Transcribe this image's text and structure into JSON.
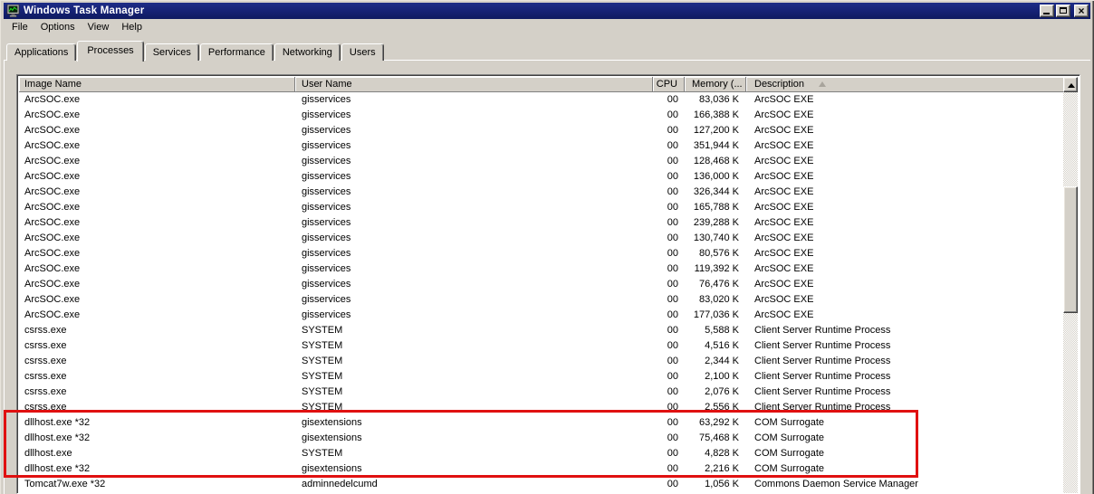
{
  "window": {
    "title": "Windows Task Manager",
    "icon": "task-manager-icon",
    "controls": [
      "minimize",
      "maximize",
      "close"
    ]
  },
  "menu": {
    "items": [
      "File",
      "Options",
      "View",
      "Help"
    ]
  },
  "tabs": {
    "active": "Processes",
    "items": [
      "Applications",
      "Processes",
      "Services",
      "Performance",
      "Networking",
      "Users"
    ]
  },
  "process_table": {
    "columns": [
      "Image Name",
      "User Name",
      "CPU",
      "Memory (...",
      "Description"
    ],
    "sorted_by": "Description",
    "sort_direction": "ascending",
    "rows": [
      {
        "image": "ArcSOC.exe",
        "user": "gisservices",
        "cpu": "00",
        "memory": "83,036 K",
        "description": "ArcSOC EXE",
        "highlighted": false
      },
      {
        "image": "ArcSOC.exe",
        "user": "gisservices",
        "cpu": "00",
        "memory": "166,388 K",
        "description": "ArcSOC EXE",
        "highlighted": false
      },
      {
        "image": "ArcSOC.exe",
        "user": "gisservices",
        "cpu": "00",
        "memory": "127,200 K",
        "description": "ArcSOC EXE",
        "highlighted": false
      },
      {
        "image": "ArcSOC.exe",
        "user": "gisservices",
        "cpu": "00",
        "memory": "351,944 K",
        "description": "ArcSOC EXE",
        "highlighted": false
      },
      {
        "image": "ArcSOC.exe",
        "user": "gisservices",
        "cpu": "00",
        "memory": "128,468 K",
        "description": "ArcSOC EXE",
        "highlighted": false
      },
      {
        "image": "ArcSOC.exe",
        "user": "gisservices",
        "cpu": "00",
        "memory": "136,000 K",
        "description": "ArcSOC EXE",
        "highlighted": false
      },
      {
        "image": "ArcSOC.exe",
        "user": "gisservices",
        "cpu": "00",
        "memory": "326,344 K",
        "description": "ArcSOC EXE",
        "highlighted": false
      },
      {
        "image": "ArcSOC.exe",
        "user": "gisservices",
        "cpu": "00",
        "memory": "165,788 K",
        "description": "ArcSOC EXE",
        "highlighted": false
      },
      {
        "image": "ArcSOC.exe",
        "user": "gisservices",
        "cpu": "00",
        "memory": "239,288 K",
        "description": "ArcSOC EXE",
        "highlighted": false
      },
      {
        "image": "ArcSOC.exe",
        "user": "gisservices",
        "cpu": "00",
        "memory": "130,740 K",
        "description": "ArcSOC EXE",
        "highlighted": false
      },
      {
        "image": "ArcSOC.exe",
        "user": "gisservices",
        "cpu": "00",
        "memory": "80,576 K",
        "description": "ArcSOC EXE",
        "highlighted": false
      },
      {
        "image": "ArcSOC.exe",
        "user": "gisservices",
        "cpu": "00",
        "memory": "119,392 K",
        "description": "ArcSOC EXE",
        "highlighted": false
      },
      {
        "image": "ArcSOC.exe",
        "user": "gisservices",
        "cpu": "00",
        "memory": "76,476 K",
        "description": "ArcSOC EXE",
        "highlighted": false
      },
      {
        "image": "ArcSOC.exe",
        "user": "gisservices",
        "cpu": "00",
        "memory": "83,020 K",
        "description": "ArcSOC EXE",
        "highlighted": false
      },
      {
        "image": "ArcSOC.exe",
        "user": "gisservices",
        "cpu": "00",
        "memory": "177,036 K",
        "description": "ArcSOC EXE",
        "highlighted": false
      },
      {
        "image": "csrss.exe",
        "user": "SYSTEM",
        "cpu": "00",
        "memory": "5,588 K",
        "description": "Client Server Runtime Process",
        "highlighted": false
      },
      {
        "image": "csrss.exe",
        "user": "SYSTEM",
        "cpu": "00",
        "memory": "4,516 K",
        "description": "Client Server Runtime Process",
        "highlighted": false
      },
      {
        "image": "csrss.exe",
        "user": "SYSTEM",
        "cpu": "00",
        "memory": "2,344 K",
        "description": "Client Server Runtime Process",
        "highlighted": false
      },
      {
        "image": "csrss.exe",
        "user": "SYSTEM",
        "cpu": "00",
        "memory": "2,100 K",
        "description": "Client Server Runtime Process",
        "highlighted": false
      },
      {
        "image": "csrss.exe",
        "user": "SYSTEM",
        "cpu": "00",
        "memory": "2,076 K",
        "description": "Client Server Runtime Process",
        "highlighted": false
      },
      {
        "image": "csrss.exe",
        "user": "SYSTEM",
        "cpu": "00",
        "memory": "2,556 K",
        "description": "Client Server Runtime Process",
        "highlighted": false
      },
      {
        "image": "dllhost.exe *32",
        "user": "gisextensions",
        "cpu": "00",
        "memory": "63,292 K",
        "description": "COM Surrogate",
        "highlighted": true
      },
      {
        "image": "dllhost.exe *32",
        "user": "gisextensions",
        "cpu": "00",
        "memory": "75,468 K",
        "description": "COM Surrogate",
        "highlighted": true
      },
      {
        "image": "dllhost.exe",
        "user": "SYSTEM",
        "cpu": "00",
        "memory": "4,828 K",
        "description": "COM Surrogate",
        "highlighted": true
      },
      {
        "image": "dllhost.exe *32",
        "user": "gisextensions",
        "cpu": "00",
        "memory": "2,216 K",
        "description": "COM Surrogate",
        "highlighted": true
      },
      {
        "image": "Tomcat7w.exe *32",
        "user": "adminnedelcumd",
        "cpu": "00",
        "memory": "1,056 K",
        "description": "Commons Daemon Service Manager",
        "highlighted": false
      }
    ]
  },
  "highlight_box": {
    "color": "#e01010"
  },
  "scrollbar": {
    "orientation": "vertical",
    "up_arrow": "scroll-up-icon"
  }
}
